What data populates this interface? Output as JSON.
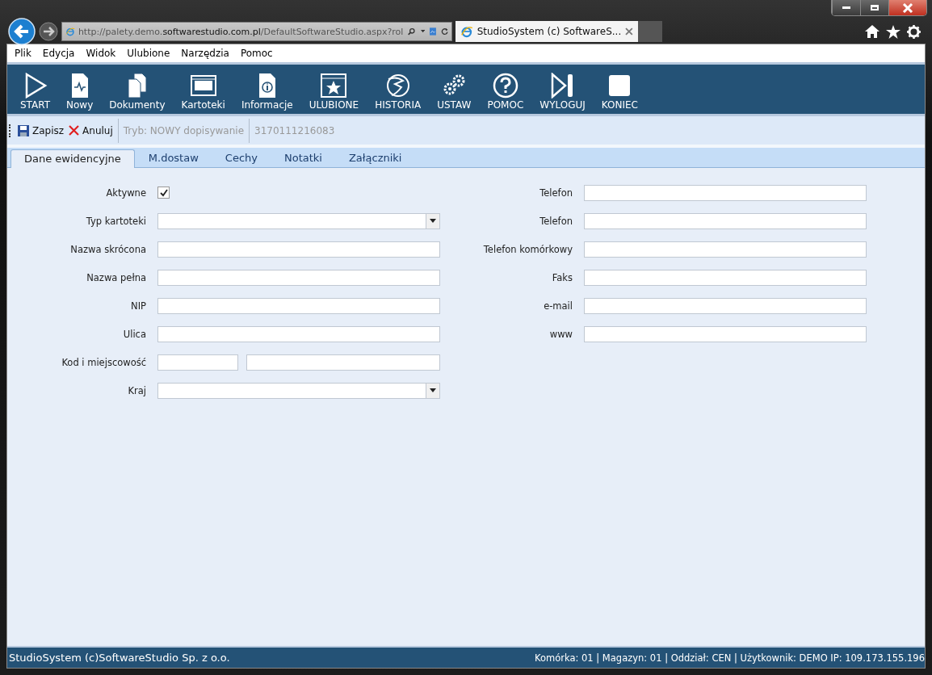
{
  "browser": {
    "url": {
      "prefix": "http://palety.demo.",
      "domain": "softwarestudio.com.pl",
      "suffix": "/DefaultSoftwareStudio.aspx?rol"
    },
    "tab_title": "StudioSystem (c) SoftwareS..."
  },
  "menu": [
    "Plik",
    "Edycja",
    "Widok",
    "Ulubione",
    "Narzędzia",
    "Pomoc"
  ],
  "toolbar": [
    "START",
    "Nowy",
    "Dokumenty",
    "Kartoteki",
    "Informacje",
    "ULUBIONE",
    "HISTORIA",
    "USTAW",
    "POMOC",
    "WYLOGUJ",
    "KONIEC"
  ],
  "actions": {
    "save": "Zapisz",
    "cancel": "Anuluj",
    "mode": "Tryb: NOWY dopisywanie",
    "number": "3170111216083"
  },
  "tabs": [
    {
      "label": "Dane ewidencyjne",
      "selected": true
    },
    {
      "label": "M.dostaw",
      "selected": false
    },
    {
      "label": "Cechy",
      "selected": false
    },
    {
      "label": "Notatki",
      "selected": false
    },
    {
      "label": "Załączniki",
      "selected": false
    }
  ],
  "left_fields": [
    {
      "label": "Aktywne",
      "kind": "checkbox",
      "checked": true
    },
    {
      "label": "Typ kartoteki",
      "kind": "select"
    },
    {
      "label": "Nazwa skrócona",
      "kind": "text"
    },
    {
      "label": "Nazwa pełna",
      "kind": "text"
    },
    {
      "label": "NIP",
      "kind": "text"
    },
    {
      "label": "Ulica",
      "kind": "text"
    },
    {
      "label": "Kod i miejscowość",
      "kind": "double"
    },
    {
      "label": "Kraj",
      "kind": "select"
    }
  ],
  "right_fields": [
    {
      "label": "Telefon"
    },
    {
      "label": "Telefon"
    },
    {
      "label": "Telefon komórkowy"
    },
    {
      "label": "Faks"
    },
    {
      "label": "e-mail"
    },
    {
      "label": "www"
    }
  ],
  "status_bar": {
    "left": "StudioSystem (c)SoftwareStudio Sp. z o.o.",
    "right": "Komórka: 01 | Magazyn: 01 | Oddział: CEN | Użytkownik: DEMO IP: 109.173.155.196"
  }
}
